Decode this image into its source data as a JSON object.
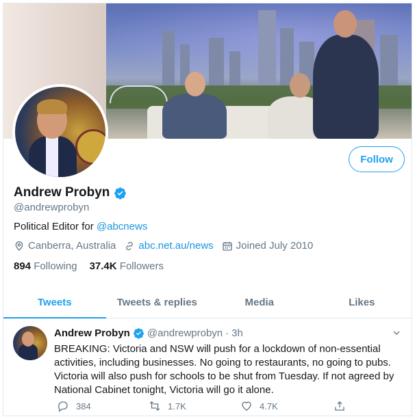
{
  "profile": {
    "name": "Andrew Probyn",
    "handle": "@andrewprobyn",
    "bio_prefix": "Political Editor for ",
    "bio_link": "@abcnews",
    "location": "Canberra, Australia",
    "website": "abc.net.au/news",
    "joined": "Joined July 2010",
    "following_count": "894",
    "following_label": "Following",
    "followers_count": "37.4K",
    "followers_label": "Followers",
    "follow_label": "Follow"
  },
  "tabs": [
    {
      "label": "Tweets",
      "active": true
    },
    {
      "label": "Tweets & replies",
      "active": false
    },
    {
      "label": "Media",
      "active": false
    },
    {
      "label": "Likes",
      "active": false
    }
  ],
  "tweet": {
    "name": "Andrew Probyn",
    "handle": "@andrewprobyn",
    "sep": "·",
    "time": "3h",
    "text": "BREAKING: Victoria and NSW will push for a lockdown of non-essential activities, including businesses. No going to restaurants, no going to pubs. Victoria will also push for schools to be shut from Tuesday. If not agreed by National Cabinet tonight, Victoria will go it alone.",
    "replies": "384",
    "retweets": "1.7K",
    "likes": "4.7K"
  },
  "colors": {
    "accent": "#1da1f2",
    "secondary_text": "#657786",
    "border": "#e1e8ed"
  },
  "icons": [
    "verified-badge-icon",
    "location-pin-icon",
    "link-icon",
    "calendar-icon",
    "chevron-down-icon",
    "reply-icon",
    "retweet-icon",
    "like-icon",
    "share-icon"
  ]
}
